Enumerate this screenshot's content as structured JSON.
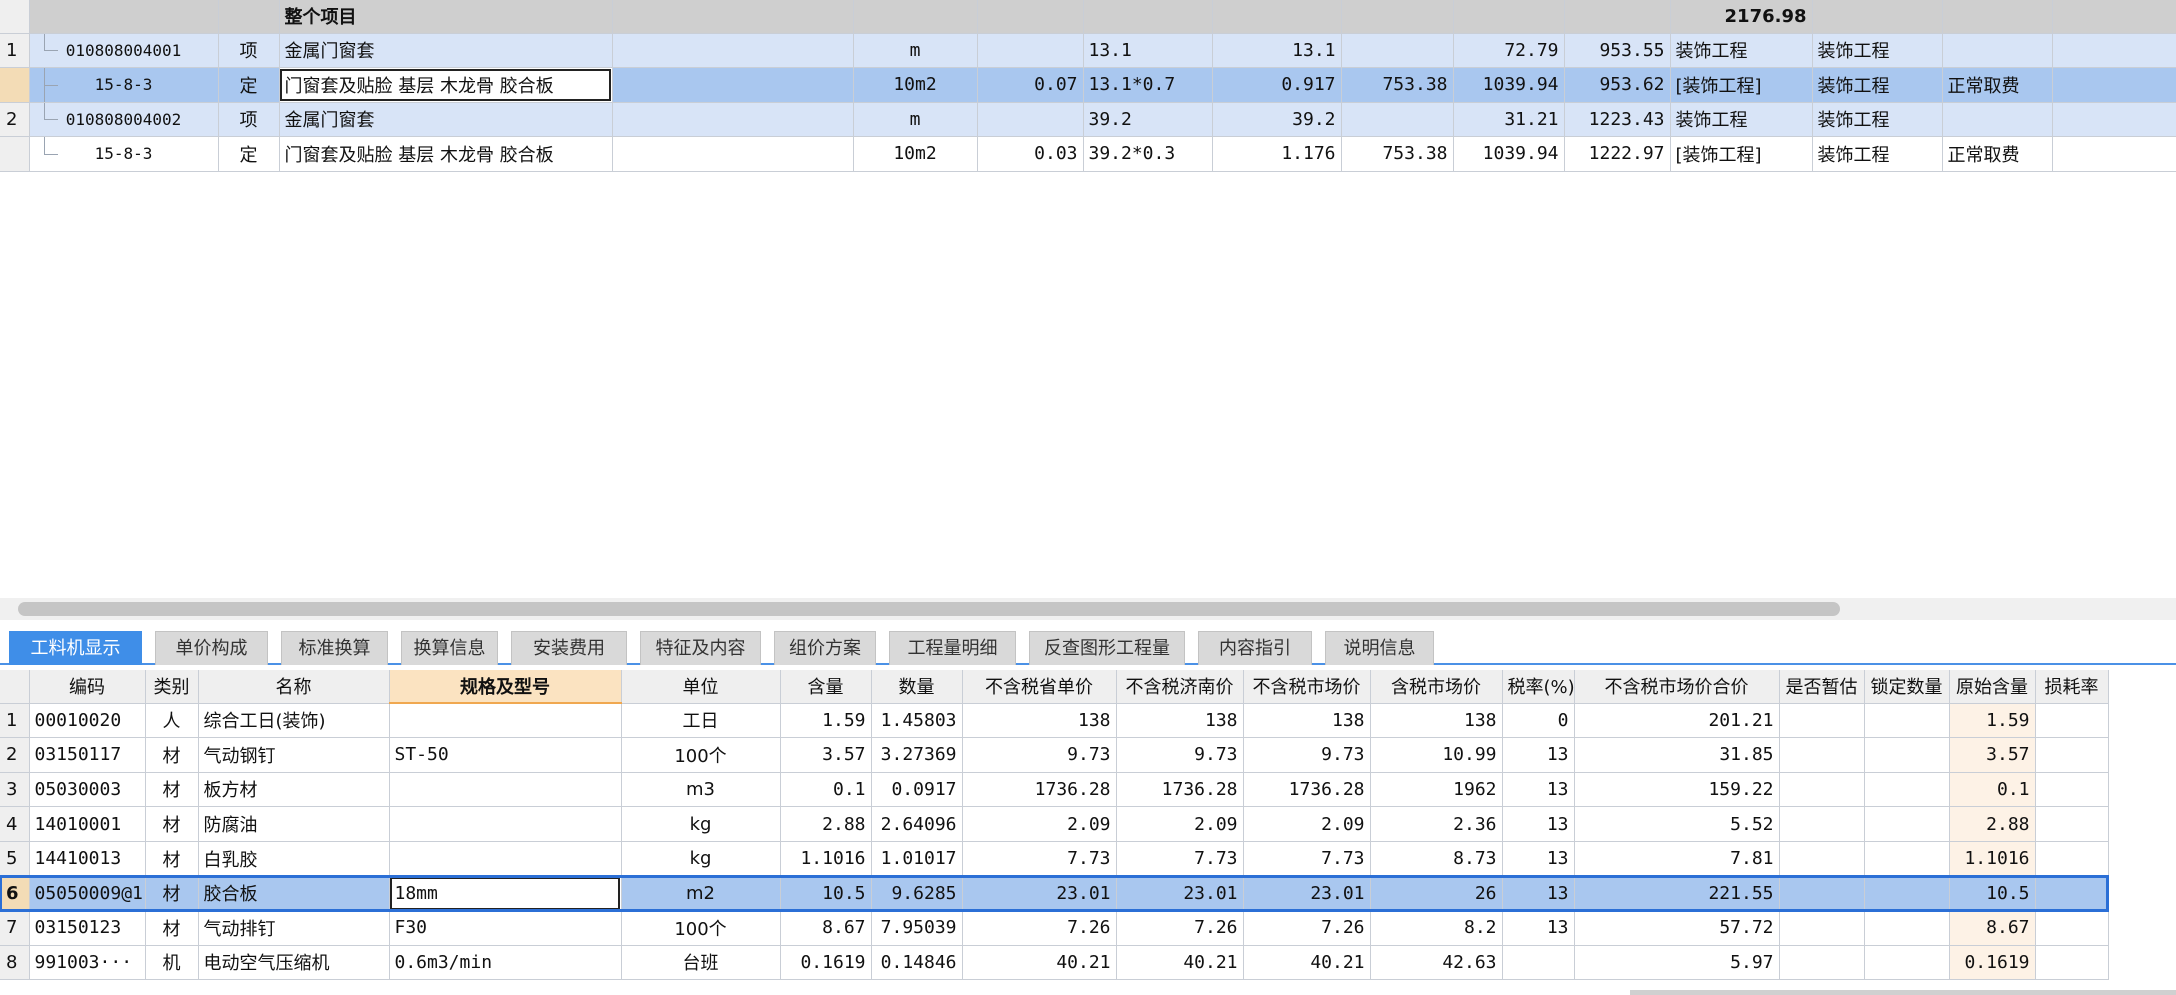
{
  "top_grid": {
    "total_row": {
      "name": "整个项目",
      "total": "2176.98"
    },
    "rows": [
      {
        "rn": "1",
        "code": "010808004001",
        "type": "项",
        "name": "金属门窗套",
        "unit": "m",
        "content": "",
        "expr": "13.1",
        "qty": "13.1",
        "price": "",
        "unit_price": "72.79",
        "sum": "953.55",
        "category": "装饰工程",
        "major": "装饰工程",
        "fee": ""
      },
      {
        "rn": "",
        "code": "15-8-3",
        "type": "定",
        "name": "门窗套及贴脸 基层 木龙骨 胶合板",
        "unit": "10m2",
        "content": "0.07",
        "expr": "13.1*0.7",
        "qty": "0.917",
        "price": "753.38",
        "unit_price": "1039.94",
        "sum": "953.62",
        "category": "[装饰工程]",
        "major": "装饰工程",
        "fee": "正常取费"
      },
      {
        "rn": "2",
        "code": "010808004002",
        "type": "项",
        "name": "金属门窗套",
        "unit": "m",
        "content": "",
        "expr": "39.2",
        "qty": "39.2",
        "price": "",
        "unit_price": "31.21",
        "sum": "1223.43",
        "category": "装饰工程",
        "major": "装饰工程",
        "fee": ""
      },
      {
        "rn": "",
        "code": "15-8-3",
        "type": "定",
        "name": "门窗套及贴脸 基层 木龙骨 胶合板",
        "unit": "10m2",
        "content": "0.03",
        "expr": "39.2*0.3",
        "qty": "1.176",
        "price": "753.38",
        "unit_price": "1039.94",
        "sum": "1222.97",
        "category": "[装饰工程]",
        "major": "装饰工程",
        "fee": "正常取费"
      }
    ]
  },
  "tabs": [
    "工料机显示",
    "单价构成",
    "标准换算",
    "换算信息",
    "安装费用",
    "特征及内容",
    "组价方案",
    "工程量明细",
    "反查图形工程量",
    "内容指引",
    "说明信息"
  ],
  "bottom_grid": {
    "headers": [
      "",
      "编码",
      "类别",
      "名称",
      "规格及型号",
      "单位",
      "含量",
      "数量",
      "不含税省单价",
      "不含税济南价",
      "不含税市场价",
      "含税市场价",
      "税率(%)",
      "不含税市场价合价",
      "是否暂估",
      "锁定数量",
      "原始含量",
      "损耗率"
    ],
    "rows": [
      {
        "rn": "1",
        "code": "00010020",
        "type": "人",
        "name": "综合工日(装饰)",
        "spec": "",
        "unit": "工日",
        "content": "1.59",
        "qty": "1.45803",
        "p1": "138",
        "p2": "138",
        "p3": "138",
        "p4": "138",
        "tax": "0",
        "total": "201.21",
        "est": "",
        "lock": "",
        "orig": "1.59",
        "loss": ""
      },
      {
        "rn": "2",
        "code": "03150117",
        "type": "材",
        "name": "气动钢钉",
        "spec": "ST-50",
        "unit": "100个",
        "content": "3.57",
        "qty": "3.27369",
        "p1": "9.73",
        "p2": "9.73",
        "p3": "9.73",
        "p4": "10.99",
        "tax": "13",
        "total": "31.85",
        "est": "",
        "lock": "",
        "orig": "3.57",
        "loss": ""
      },
      {
        "rn": "3",
        "code": "05030003",
        "type": "材",
        "name": "板方材",
        "spec": "",
        "unit": "m3",
        "content": "0.1",
        "qty": "0.0917",
        "p1": "1736.28",
        "p2": "1736.28",
        "p3": "1736.28",
        "p4": "1962",
        "tax": "13",
        "total": "159.22",
        "est": "",
        "lock": "",
        "orig": "0.1",
        "loss": ""
      },
      {
        "rn": "4",
        "code": "14010001",
        "type": "材",
        "name": "防腐油",
        "spec": "",
        "unit": "kg",
        "content": "2.88",
        "qty": "2.64096",
        "p1": "2.09",
        "p2": "2.09",
        "p3": "2.09",
        "p4": "2.36",
        "tax": "13",
        "total": "5.52",
        "est": "",
        "lock": "",
        "orig": "2.88",
        "loss": ""
      },
      {
        "rn": "5",
        "code": "14410013",
        "type": "材",
        "name": "白乳胶",
        "spec": "",
        "unit": "kg",
        "content": "1.1016",
        "qty": "1.01017",
        "p1": "7.73",
        "p2": "7.73",
        "p3": "7.73",
        "p4": "8.73",
        "tax": "13",
        "total": "7.81",
        "est": "",
        "lock": "",
        "orig": "1.1016",
        "loss": ""
      },
      {
        "rn": "6",
        "code": "05050009@1",
        "type": "材",
        "name": "胶合板",
        "spec": "18mm",
        "unit": "m2",
        "content": "10.5",
        "qty": "9.6285",
        "p1": "23.01",
        "p2": "23.01",
        "p3": "23.01",
        "p4": "26",
        "tax": "13",
        "total": "221.55",
        "est": "",
        "lock": "",
        "orig": "10.5",
        "loss": ""
      },
      {
        "rn": "7",
        "code": "03150123",
        "type": "材",
        "name": "气动排钉",
        "spec": "F30",
        "unit": "100个",
        "content": "8.67",
        "qty": "7.95039",
        "p1": "7.26",
        "p2": "7.26",
        "p3": "7.26",
        "p4": "8.2",
        "tax": "13",
        "total": "57.72",
        "est": "",
        "lock": "",
        "orig": "8.67",
        "loss": ""
      },
      {
        "rn": "8",
        "code": "991003···",
        "type": "机",
        "name": "电动空气压缩机",
        "spec": "0.6m3/min",
        "unit": "台班",
        "content": "0.1619",
        "qty": "0.14846",
        "p1": "40.21",
        "p2": "40.21",
        "p3": "40.21",
        "p4": "42.63",
        "tax": "",
        "total": "5.97",
        "est": "",
        "lock": "",
        "orig": "0.1619",
        "loss": ""
      }
    ]
  }
}
